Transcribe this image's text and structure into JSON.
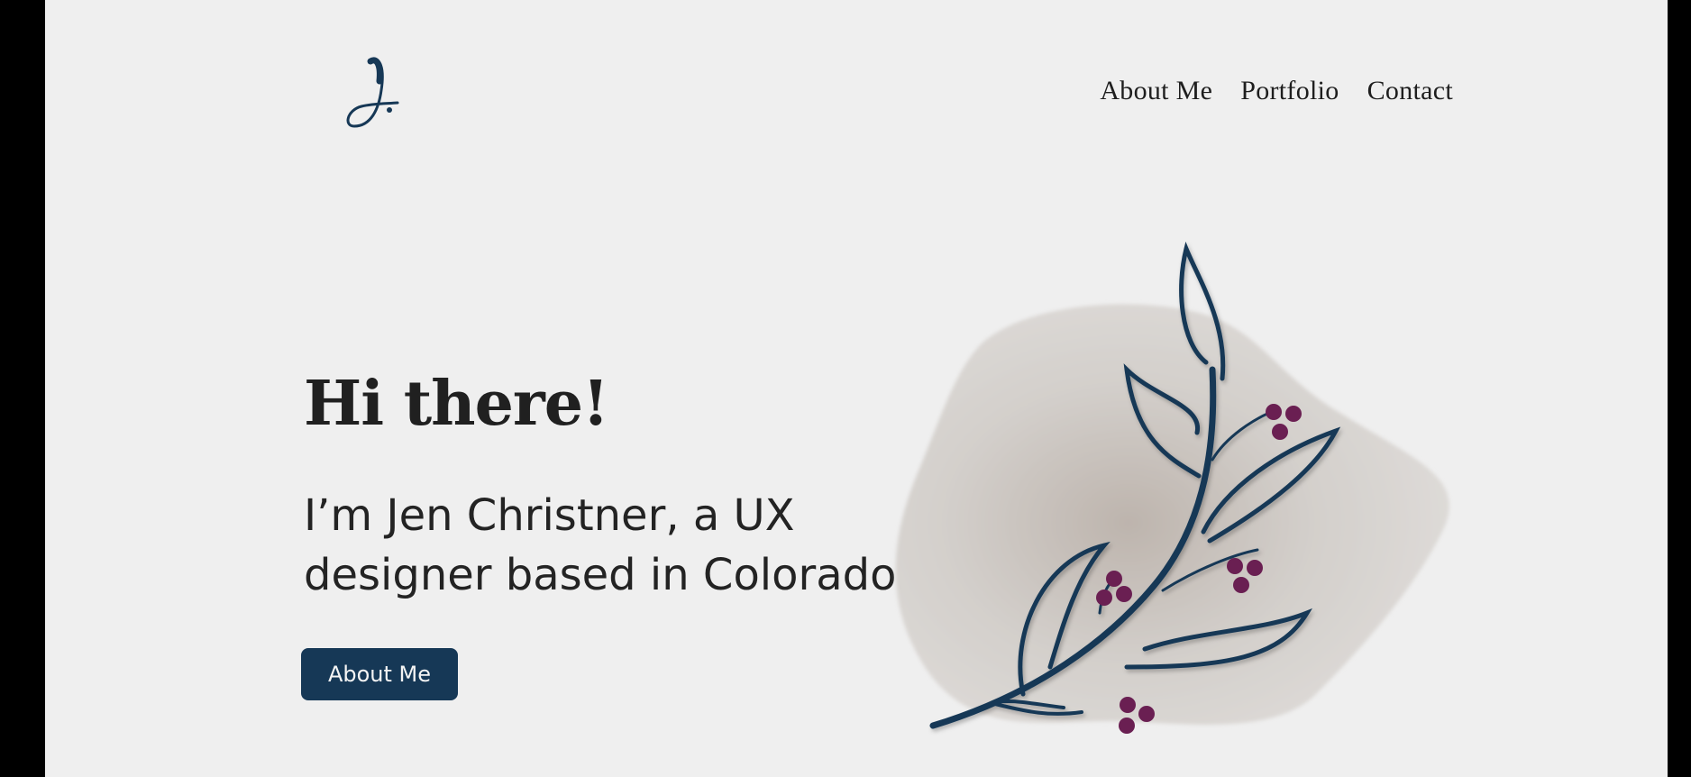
{
  "logo": {
    "alt": "J."
  },
  "nav": {
    "items": [
      {
        "label": "About Me"
      },
      {
        "label": "Portfolio"
      },
      {
        "label": "Contact"
      }
    ]
  },
  "hero": {
    "title": "Hi there!",
    "subtitle": "I’m Jen Christner, a UX designer based in Colorado.",
    "cta_label": "About Me"
  },
  "illustration": {
    "blob_color": "#d9d6d2",
    "stem_color": "#163856",
    "berry_color": "#6a1f52"
  },
  "colors": {
    "page_background": "#efefef",
    "outer_background": "#000000",
    "button_background": "#163856",
    "text": "#202020"
  }
}
